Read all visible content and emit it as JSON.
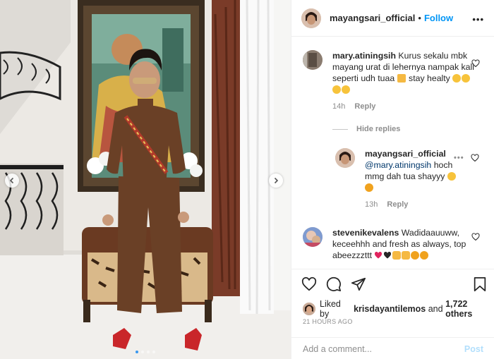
{
  "colors": {
    "accent": "#0095f6",
    "text": "#262626",
    "muted": "#8e8e8e",
    "post_disabled": "#b2dffc"
  },
  "photo": {
    "carousel_dots": 4,
    "active_dot": 0
  },
  "header": {
    "username": "mayangsari_official",
    "separator": "•",
    "follow_label": "Follow",
    "more_label": "•••"
  },
  "comments": [
    {
      "username": "mary.atiningsih",
      "text": "Kurus sekalu mbk mayang urat di lehernya nampak kali seperti udh tuaa",
      "text_tail": "stay healty",
      "time": "14h",
      "reply_label": "Reply",
      "hide_replies_label": "Hide replies"
    },
    {
      "username": "mayangsari_official",
      "mention": "@mary.atiningsih",
      "text": "hoch mmg dah tua shayyy",
      "time": "13h",
      "reply_label": "Reply"
    },
    {
      "username": "stevenikevalens",
      "text": "Wadidaauuww, keceehhh and fresh as always, top abeezzzttt"
    }
  ],
  "actions": {
    "icons": [
      "heart-icon",
      "comment-icon",
      "share-icon",
      "bookmark-icon"
    ],
    "liked_by_prefix": "Liked by",
    "liked_by_user": "krisdayantilemos",
    "liked_by_and": "and",
    "liked_by_count": "1,722 others",
    "timestamp": "21 HOURS AGO"
  },
  "composer": {
    "placeholder": "Add a comment...",
    "post_label": "Post"
  }
}
